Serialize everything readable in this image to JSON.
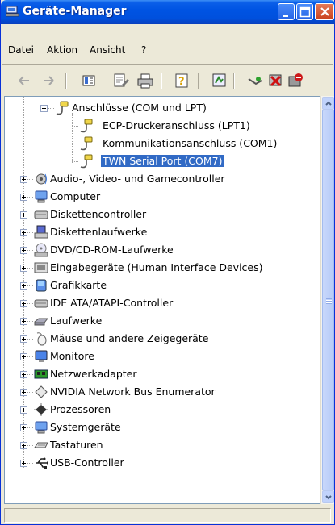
{
  "window": {
    "title": "Geräte-Manager"
  },
  "menu": [
    "Datei",
    "Aktion",
    "Ansicht",
    "?"
  ],
  "toolbar": [
    "back-icon",
    "forward-icon",
    "properties-view-icon",
    "properties-icon",
    "print-icon",
    "help-icon",
    "scan-hardware-icon",
    "update-driver-icon",
    "uninstall-icon",
    "disable-icon"
  ],
  "tree": {
    "ports_category": "Anschlüsse (COM und LPT)",
    "ports_children": [
      "ECP-Druckeranschluss (LPT1)",
      "Kommunikationsanschluss (COM1)",
      "TWN Serial Port (COM7)"
    ],
    "selected_item": "TWN Serial Port (COM7)",
    "categories": [
      "Audio-, Video- und Gamecontroller",
      "Computer",
      "Diskettencontroller",
      "Diskettenlaufwerke",
      "DVD/CD-ROM-Laufwerke",
      "Eingabegeräte (Human Interface Devices)",
      "Grafikkarte",
      "IDE ATA/ATAPI-Controller",
      "Laufwerke",
      "Mäuse und andere Zeigegeräte",
      "Monitore",
      "Netzwerkadapter",
      "NVIDIA Network Bus Enumerator",
      "Prozessoren",
      "Systemgeräte",
      "Tastaturen",
      "USB-Controller"
    ]
  },
  "status": {
    "text": ""
  }
}
